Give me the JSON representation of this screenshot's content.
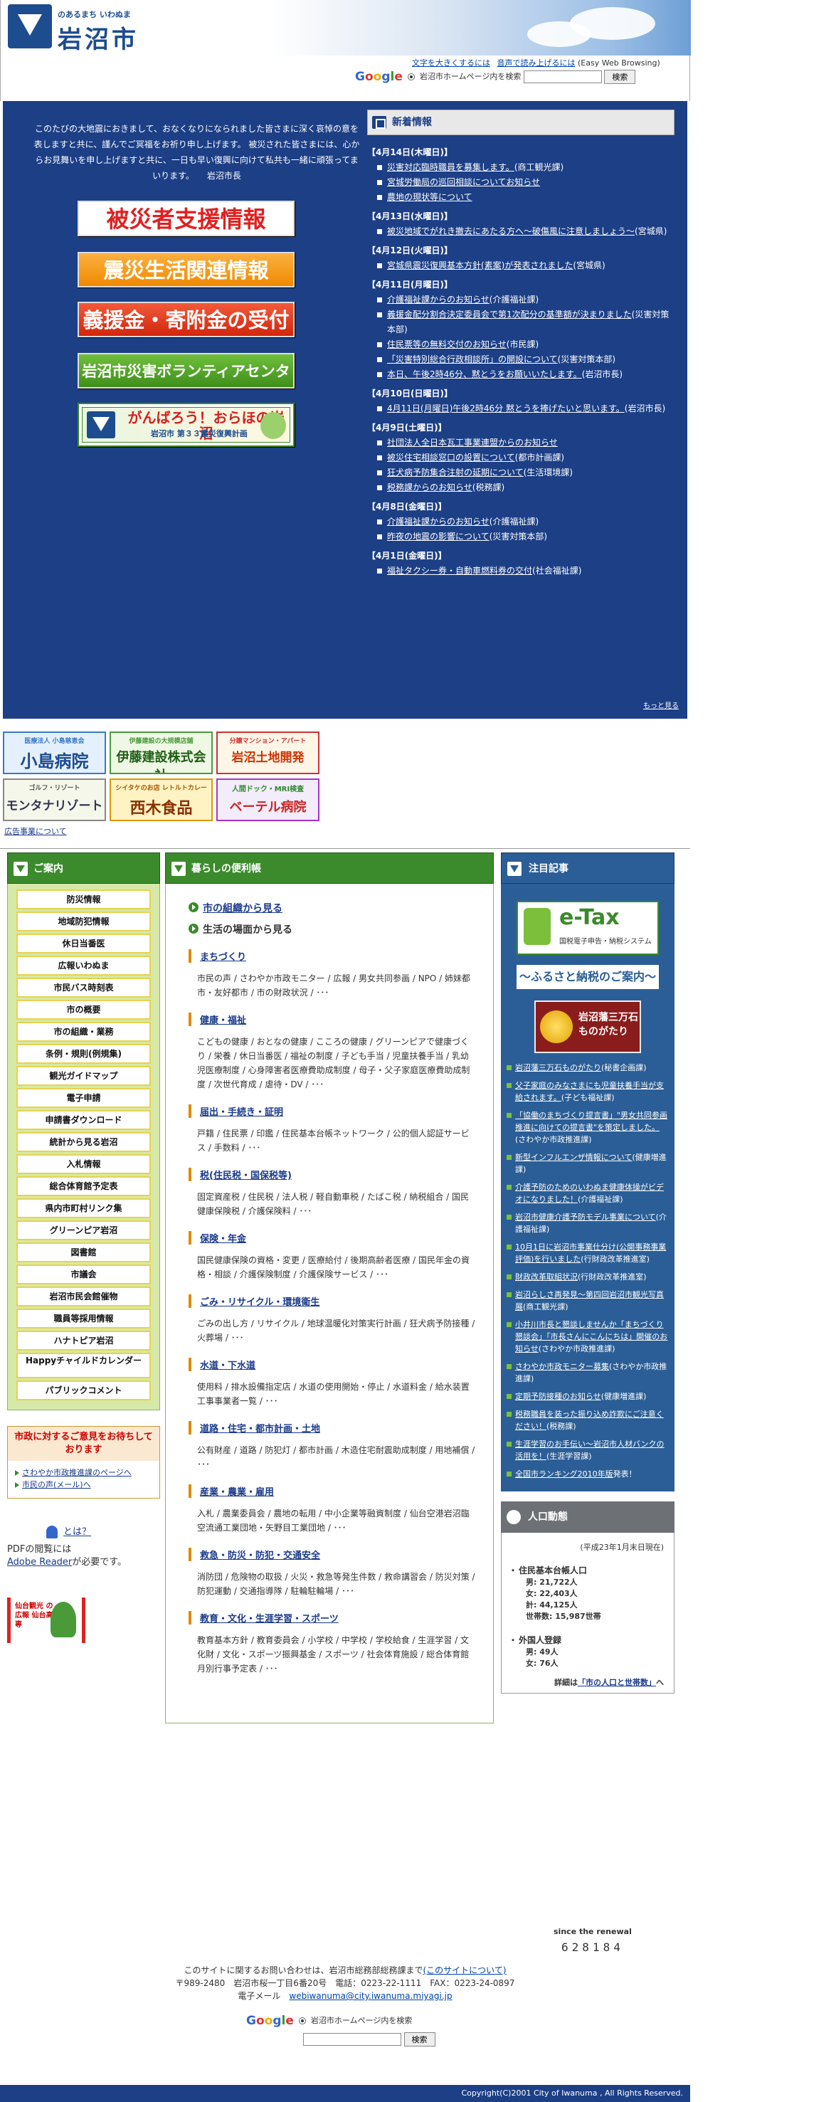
{
  "header": {
    "tagline": "のあるまち いわぬま",
    "city_name": "岩沼市",
    "links": [
      {
        "label": "文字を大きくするには"
      },
      {
        "label": "音声で読み上げるには"
      },
      {
        "label": "(Easy Web Browsing)"
      }
    ],
    "search": {
      "option": "岩沼市ホームページ内を検索",
      "button": "検索",
      "google": [
        "G",
        "o",
        "o",
        "g",
        "l",
        "e"
      ]
    }
  },
  "intro": {
    "text": "このたびの大地震におきまして、おなくなりになられました皆さまに深く哀悼の意を表しますと共に、謹んでご冥福をお祈り申し上げます。 被災された皆さまには、心からお見舞いを申し上げますと共に、一日も早い復興に向けて私共も一緒に頑張ってまいります。　　岩沼市長"
  },
  "banners": {
    "b1": "被災者支援情報",
    "b2": "震災生活関連情報",
    "b3": "義援金・寄附金の受付",
    "b4": "岩沼市災害ボランティアセンター",
    "b5_t1": "がんばろう！おらほの岩沼",
    "b5_t2": "岩沼市 第３３震災復興計画"
  },
  "news": {
    "title": "新着情報",
    "groups": [
      {
        "date": "【4月14日(木曜日)】",
        "items": [
          {
            "link": "災害対応臨時職員を募集します。",
            "note": "(商工観光課)"
          },
          {
            "link": "宮城労働局の巡回相談についてお知らせ",
            "note": ""
          },
          {
            "link": "農地の現状等について",
            "note": ""
          }
        ]
      },
      {
        "date": "【4月13日(水曜日)】",
        "items": [
          {
            "link": "被災地域でがれき撤去にあたる方へ～破傷風に注意しましょう～",
            "note": "(宮城県)"
          }
        ]
      },
      {
        "date": "【4月12日(火曜日)】",
        "items": [
          {
            "link": "宮城県震災復興基本方針(素案)が発表されました",
            "note": "(宮城県)"
          }
        ]
      },
      {
        "date": "【4月11日(月曜日)】",
        "items": [
          {
            "link": "介護福祉課からのお知らせ",
            "note": "(介護福祉課)"
          },
          {
            "link": "義援金配分割合決定委員会で第1次配分の基準額が決まりました",
            "note": "(災害対策本部)"
          },
          {
            "link": "住民票等の無料交付のお知らせ",
            "note": "(市民課)"
          },
          {
            "link": "「災害特別総合行政相談所」の開設について",
            "note": "(災害対策本部)"
          },
          {
            "link": "本日、午後2時46分、黙とうをお願いいたします。",
            "note": "(岩沼市長)"
          }
        ]
      },
      {
        "date": "【4月10日(日曜日)】",
        "items": [
          {
            "link": "4月11日(月曜日)午後2時46分 黙とうを捧げたいと思います。",
            "note": "(岩沼市長)"
          }
        ]
      },
      {
        "date": "【4月9日(土曜日)】",
        "items": [
          {
            "link": "社団法人全日本瓦工事業連盟からのお知らせ",
            "note": ""
          },
          {
            "link": "被災住宅相談窓口の設置について",
            "note": "(都市計画課)"
          },
          {
            "link": "狂犬病予防集合注射の延期について",
            "note": "(生活環境課)"
          },
          {
            "link": "税務課からのお知らせ",
            "note": "(税務課)"
          }
        ]
      },
      {
        "date": "【4月8日(金曜日)】",
        "items": [
          {
            "link": "介護福祉課からのお知らせ",
            "note": "(介護福祉課)"
          },
          {
            "link": "昨夜の地震の影響について",
            "note": "(災害対策本部)"
          }
        ]
      },
      {
        "date": "【4月1日(金曜日)】",
        "items": [
          {
            "link": "福祉タクシー券・自動車燃料券の交付",
            "note": "(社会福祉課)"
          }
        ]
      }
    ],
    "more": "もっと見る"
  },
  "ads": {
    "items": [
      {
        "small": "医療法人 小島慈恵会",
        "big": "小島病院"
      },
      {
        "small": "伊藤建設の大規模店舗",
        "big": "伊藤建設株式会社"
      },
      {
        "small": "分譲マンション・アパート",
        "big": "岩沼土地開発"
      },
      {
        "small": "ゴルフ・リゾート",
        "big": "モンタナリゾート"
      },
      {
        "small": "シイタケのお店 レトルトカレー",
        "big": "西木食品"
      },
      {
        "small": "人間ドック・MRI検査",
        "big": "ベーテル病院"
      }
    ],
    "note": "広告事業について"
  },
  "leftnav": {
    "title": "ご案内",
    "items": [
      "防災情報",
      "地域防犯情報",
      "休日当番医",
      "広報いわぬま",
      "市民バス時刻表",
      "市の概要",
      "市の組織・業務",
      "条例・規則(例規集)",
      "観光ガイドマップ",
      "電子申請",
      "申請書ダウンロード",
      "統計から見る岩沼",
      "入札情報",
      "総合体育館予定表",
      "県内市町村リンク集",
      "グリーンピア岩沼",
      "図書館",
      "市議会",
      "岩沼市民会館催物",
      "職員等採用情報",
      "ハナトピア岩沼",
      "Happyチャイルドカレンダー",
      "パブリックコメント"
    ],
    "opinion_title": "市政に対するご意見をお待ちしております",
    "opinion_links": [
      "さわやか市政推進課のページへ",
      "市民の声(メール)へ"
    ],
    "adobe_link": "とは？",
    "adobe_text1": "PDFの閲覧には",
    "adobe_reader": "Adobe Reader",
    "adobe_text2": "が必要です。",
    "kahoku": "仙台観光 の広報 仙台高専"
  },
  "middle": {
    "title": "暮らしの便利帳",
    "big1": "市の組織から見る",
    "big2": "生活の場面から見る",
    "cats": [
      {
        "title": "まちづくり",
        "desc": "市民の声 / さわやか市政モニター / 広報 / 男女共同参画 / NPO / 姉妹都市・友好都市 / 市の財政状況 / ･･･"
      },
      {
        "title": "健康・福祉",
        "desc": "こどもの健康 / おとなの健康 / こころの健康 / グリーンピアで健康づくり / 栄養 / 休日当番医 / 福祉の制度 / 子ども手当 / 児童扶養手当 / 乳幼児医療制度 / 心身障害者医療費助成制度 / 母子・父子家庭医療費助成制度 / 次世代育成 / 虐待・DV / ･･･"
      },
      {
        "title": "届出・手続き・証明",
        "desc": "戸籍 / 住民票 / 印鑑 / 住民基本台帳ネットワーク / 公的個人認証サービス / 手数料 / ･･･"
      },
      {
        "title": "税(住民税・国保税等)",
        "desc": "固定資産税 / 住民税 / 法人税 / 軽自動車税 / たばこ税 / 納税組合 / 国民健康保険税 / 介護保険料 / ･･･"
      },
      {
        "title": "保険・年金",
        "desc": "国民健康保険の資格・変更 / 医療給付 / 後期高齢者医療 / 国民年金の資格・相談 / 介護保険制度 / 介護保険サービス / ･･･"
      },
      {
        "title": "ごみ・リサイクル・環境衛生",
        "desc": "ごみの出し方 / リサイクル / 地球温暖化対策実行計画 / 狂犬病予防接種 / 火葬場 / ･･･"
      },
      {
        "title": "水道・下水道",
        "desc": "使用料 / 排水設備指定店 / 水道の使用開始・停止 / 水道料金 / 給水装置工事事業者一覧 / ･･･"
      },
      {
        "title": "道路・住宅・都市計画・土地",
        "desc": "公有財産 / 道路 / 防犯灯 / 都市計画 / 木造住宅耐震助成制度 / 用地補償 / ･･･"
      },
      {
        "title": "産業・農業・雇用",
        "desc": "入札 / 農業委員会 / 農地の転用 / 中小企業等融資制度 / 仙台空港岩沼臨空流通工業団地・矢野目工業団地 / ･･･"
      },
      {
        "title": "救急・防災・防犯・交通安全",
        "desc": "消防団 / 危険物の取扱 / 火災・救急等発生件数 / 救命講習会 / 防災対策 / 防犯運動 / 交通指導隊 / 駐輪駐輪場 / ･･･"
      },
      {
        "title": "教育・文化・生涯学習・スポーツ",
        "desc": "教育基本方針 / 教育委員会 / 小学校 / 中学校 / 学校給食 / 生涯学習 / 文化財 / 文化・スポーツ振興基金 / スポーツ / 社会体育施設 / 総合体育館月別行事予定表 / ･･･"
      }
    ]
  },
  "right": {
    "title": "注目記事",
    "etax_title": "e-Tax",
    "etax_sub": "国税電子申告・納税システム",
    "furusato": "～ふるさと納税のご案内～",
    "mono_t": "岩沼藩三万石ものがたり",
    "items": [
      {
        "link": "岩沼藩三万石ものがたり",
        "note": "(秘書企画課)"
      },
      {
        "link": "父子家庭のみなさまにも児童扶養手当が支給されます。",
        "note": "(子ども福祉課)"
      },
      {
        "link": "「協働のまちづくり提言書」\"男女共同参画推進に向けての提言書\"を策定しました。",
        "note": "(さわやか市政推進課)"
      },
      {
        "link": "新型インフルエンザ情報について",
        "note": "(健康増進課)"
      },
      {
        "link": "介護予防のためのいわぬま健康体操がビデオになりました！",
        "note": "(介護福祉課)"
      },
      {
        "link": "岩沼市健康介護予防モデル事業について",
        "note": "(介護福祉課)"
      },
      {
        "link": "10月1日に岩沼市事業仕分け(公開事務事業評価)を行いました",
        "note": "(行財政改革推進室)"
      },
      {
        "link": "財政改革取組状況",
        "note": "(行財政改革推進室)"
      },
      {
        "link": "岩沼らしさ再発見～第四回岩沼市観光写真展",
        "note": "(商工観光課)"
      },
      {
        "link": "小井川市長と懇談しませんか「まちづくり懇談会」「市長さんにこんにちは」開催のお知らせ",
        "note": "(さわやか市政推進課)"
      },
      {
        "link": "さわやか市政モニター募集",
        "note": "(さわやか市政推進課)"
      },
      {
        "link": "定期予防接種のお知らせ",
        "note": "(健康増進課)"
      },
      {
        "link": "税務職員を装った振り込め詐欺にご注意ください！",
        "note": "(税務課)"
      },
      {
        "link": "生涯学習のお手伝い～岩沼市人材バンクの活用を！",
        "note": "(生涯学習課)"
      },
      {
        "link": "全国市ランキング2010年版",
        "note": "発表！"
      }
    ],
    "pop_title": "人口動態",
    "pop_date": "(平成23年1月末日現在)",
    "pop_h1": "住民基本台帳人口",
    "pop_v1": [
      "男: 21,722人",
      "女: 22,403人",
      "計: 44,125人",
      "世帯数: 15,987世帯"
    ],
    "pop_h2": "外国人登録",
    "pop_v2": [
      "男: 49人",
      "女: 76人"
    ],
    "pop_link_pre": "詳細は",
    "pop_link": "「市の人口と世帯数」",
    "pop_link_post": "へ"
  },
  "counter": {
    "label": "since the renewal",
    "value": "628184"
  },
  "footer": {
    "l1a": "このサイトに関するお問い合わせは、岩沼市総務部総務課まで",
    "l1b": "(このサイトについて)",
    "l2": "〒989-2480　岩沼市桜一丁目6番20号　電話：0223-22-1111　FAX：0223-24-0897",
    "l3a": "電子メール　",
    "l3b": "webiwanuma@city.iwanuma.miyagi.jp",
    "search_option": "岩沼市ホームページ内を検索",
    "search_button": "検索",
    "copyright": "Copyright(C)2001 City of Iwanuma , All Rights Reserved."
  }
}
